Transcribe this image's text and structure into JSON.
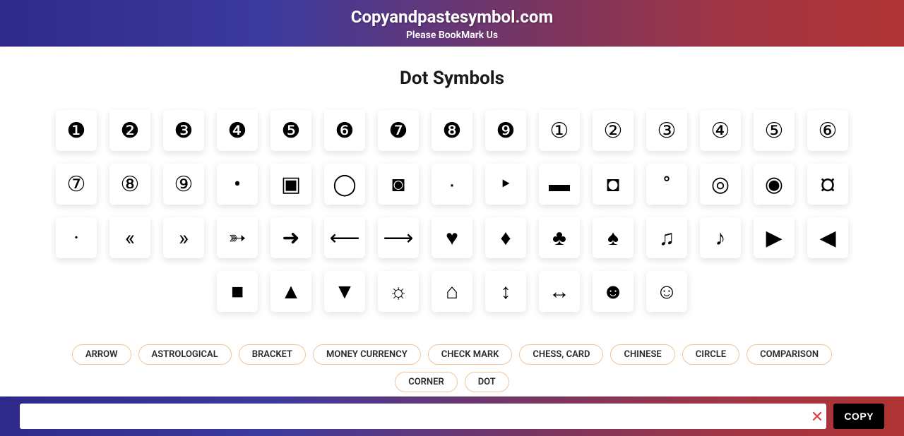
{
  "header": {
    "title": "Copyandpastesymbol.com",
    "subtitle": "Please BookMark Us"
  },
  "page_title": "Dot Symbols",
  "symbols": [
    "❶",
    "❷",
    "❸",
    "❹",
    "❺",
    "❻",
    "❼",
    "❽",
    "❾",
    "①",
    "②",
    "③",
    "④",
    "⑤",
    "⑥",
    "⑦",
    "⑧",
    "⑨",
    "•",
    "▣",
    "◯",
    "◙",
    "∙",
    "‣",
    "▬",
    "◘",
    "°",
    "◎",
    "◉",
    "¤",
    "·",
    "«",
    "»",
    "➳",
    "➜",
    "⟵",
    "⟶",
    "♥",
    "♦",
    "♣",
    "♠",
    "♫",
    "♪",
    "▶",
    "◀",
    "■",
    "▲",
    "▼",
    "☼",
    "⌂",
    "↕",
    "↔",
    "☻",
    "☺"
  ],
  "tags": [
    "ARROW",
    "ASTROLOGICAL",
    "BRACKET",
    "MONEY CURRENCY",
    "CHECK MARK",
    "CHESS, CARD",
    "CHINESE",
    "CIRCLE",
    "COMPARISON",
    "CORNER",
    "DOT"
  ],
  "footer": {
    "copy_label": "COPY",
    "input_value": ""
  }
}
